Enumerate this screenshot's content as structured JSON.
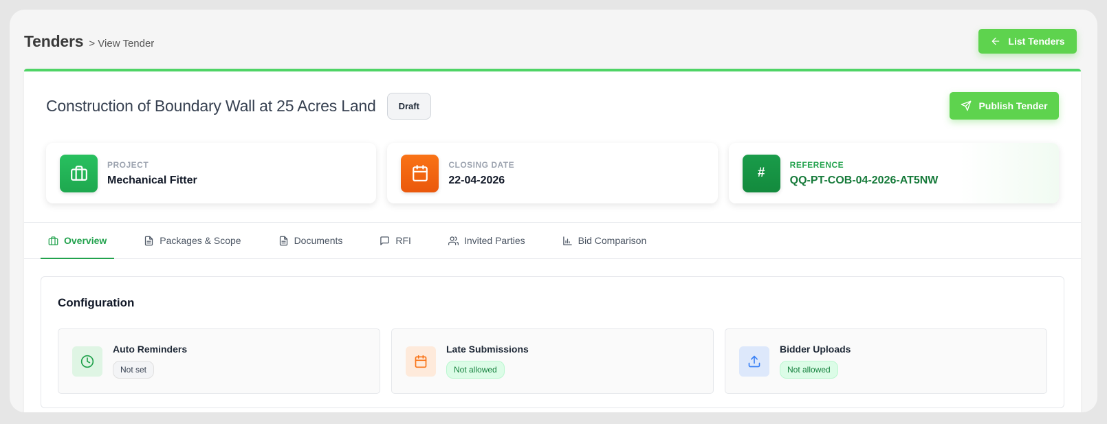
{
  "breadcrumb": {
    "title": "Tenders",
    "sub": "> View Tender"
  },
  "actions": {
    "list_tenders": "List Tenders",
    "publish": "Publish Tender"
  },
  "tender": {
    "title": "Construction of Boundary Wall at 25 Acres Land",
    "status": "Draft"
  },
  "info_cards": [
    {
      "label": "PROJECT",
      "value": "Mechanical Fitter",
      "icon": "briefcase-icon"
    },
    {
      "label": "CLOSING DATE",
      "value": "22-04-2026",
      "icon": "calendar-icon"
    },
    {
      "label": "REFERENCE",
      "value": "QQ-PT-COB-04-2026-AT5NW",
      "icon": "hash-icon",
      "glyph": "#"
    }
  ],
  "tabs": [
    {
      "label": "Overview",
      "icon": "briefcase-icon",
      "active": true
    },
    {
      "label": "Packages & Scope",
      "icon": "file-icon"
    },
    {
      "label": "Documents",
      "icon": "file-icon"
    },
    {
      "label": "RFI",
      "icon": "message-icon"
    },
    {
      "label": "Invited Parties",
      "icon": "users-icon"
    },
    {
      "label": "Bid Comparison",
      "icon": "bar-chart-icon"
    }
  ],
  "configuration": {
    "title": "Configuration",
    "items": [
      {
        "title": "Auto Reminders",
        "value": "Not set",
        "icon": "clock-icon"
      },
      {
        "title": "Late Submissions",
        "value": "Not allowed",
        "icon": "calendar-icon"
      },
      {
        "title": "Bidder Uploads",
        "value": "Not allowed",
        "icon": "upload-icon"
      }
    ]
  },
  "colors": {
    "accent": "#5ed34e",
    "active_tab": "#22a24d",
    "orange": "#f97316",
    "blue": "#3b82f6"
  }
}
